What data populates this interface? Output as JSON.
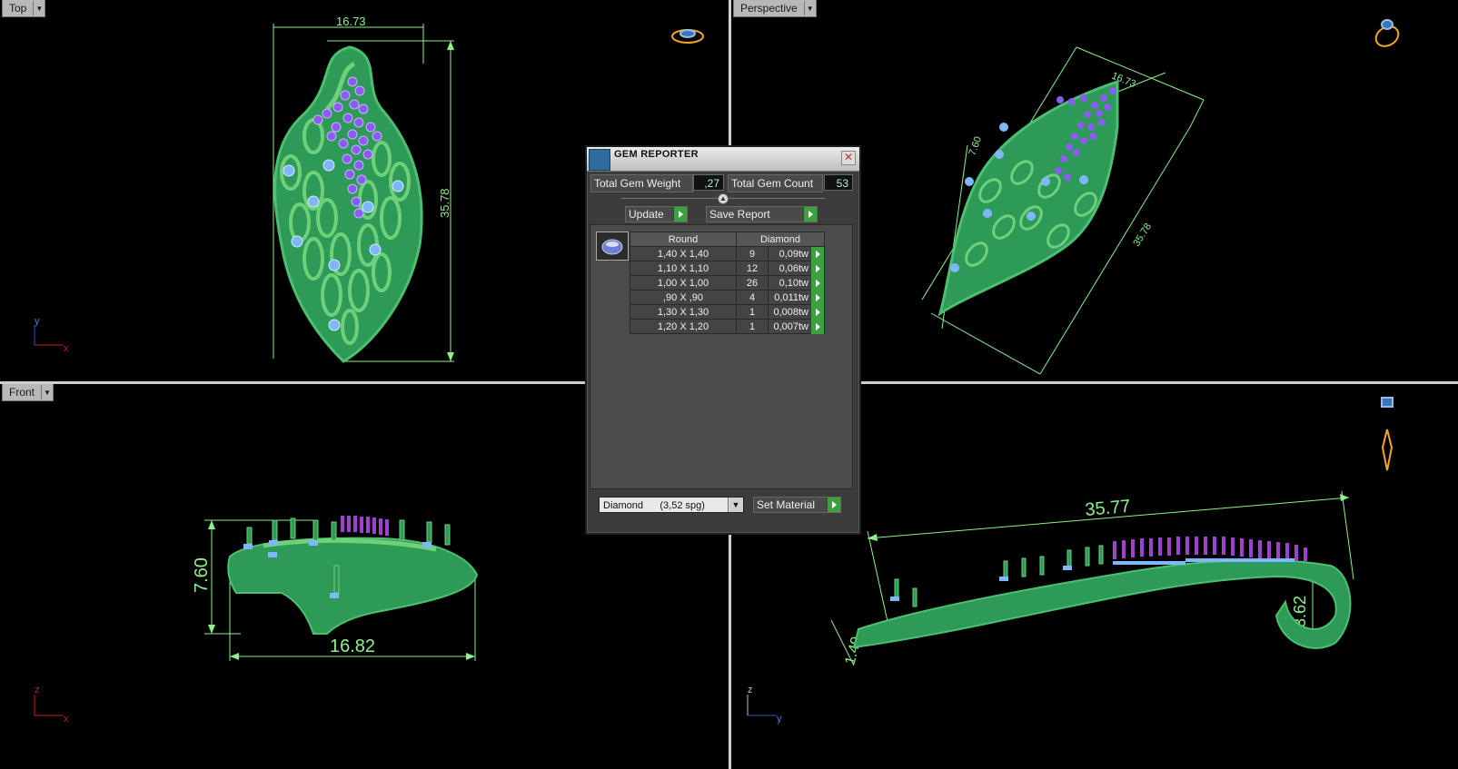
{
  "viewports": {
    "top": {
      "label": "Top",
      "dims": {
        "width": "16.73",
        "height": "35.78"
      },
      "axes": {
        "h": "x",
        "v": "y"
      }
    },
    "perspective": {
      "label": "Perspective",
      "dims": {
        "width": "16.73",
        "height": "7.60",
        "length": "35.78"
      }
    },
    "front": {
      "label": "Front",
      "dims": {
        "height": "7.60",
        "width": "16.82"
      },
      "axes": {
        "h": "x",
        "v": "z"
      }
    },
    "side": {
      "dims": {
        "length": "35.77",
        "loop": "3.62",
        "thickness": "1.49"
      },
      "axes": {
        "h": "y",
        "v": "z"
      }
    }
  },
  "gem_reporter": {
    "title": "GEM REPORTER",
    "total_weight_label": "Total Gem Weight",
    "total_weight_value": ",27",
    "total_count_label": "Total Gem Count",
    "total_count_value": "53",
    "update_label": "Update",
    "save_report_label": "Save Report",
    "table": {
      "headers": [
        "Round",
        "Diamond"
      ],
      "rows": [
        {
          "size": "1,40 X 1,40",
          "count": "9",
          "weight": "0,09tw"
        },
        {
          "size": "1,10 X 1,10",
          "count": "12",
          "weight": "0,06tw"
        },
        {
          "size": "1,00 X 1,00",
          "count": "26",
          "weight": "0,10tw"
        },
        {
          "size": ",90 X ,90",
          "count": "4",
          "weight": "0,011tw"
        },
        {
          "size": "1,30 X 1,30",
          "count": "1",
          "weight": "0,008tw"
        },
        {
          "size": "1,20 X 1,20",
          "count": "1",
          "weight": "0,007tw"
        }
      ]
    },
    "material_select": "Diamond      (3,52 spg)",
    "set_material_label": "Set Material"
  },
  "colors": {
    "metal": "#2e9a58",
    "metal_light": "#6fd07a",
    "gem_purple": "#8b5cf0",
    "gem_blue": "#7fb7ff",
    "dimension": "#8cf28c",
    "prong_purple": "#a040d0"
  }
}
